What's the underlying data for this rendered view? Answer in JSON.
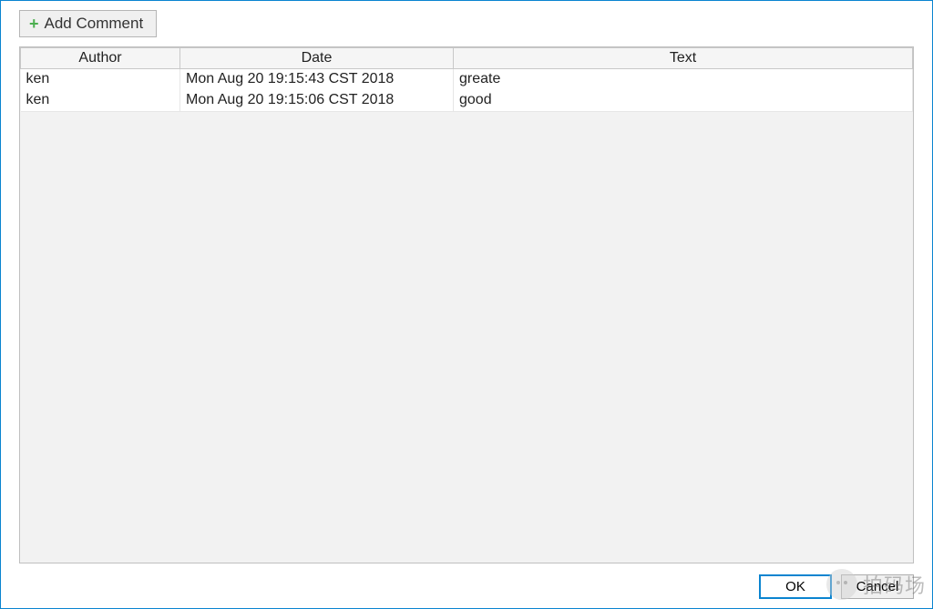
{
  "toolbar": {
    "add_comment_label": "Add Comment"
  },
  "table": {
    "headers": {
      "author": "Author",
      "date": "Date",
      "text": "Text"
    },
    "rows": [
      {
        "author": "ken",
        "date": "Mon Aug 20 19:15:43 CST 2018",
        "text": "greate"
      },
      {
        "author": "ken",
        "date": "Mon Aug 20 19:15:06 CST 2018",
        "text": "good"
      }
    ]
  },
  "footer": {
    "ok_label": "OK",
    "cancel_label": "Cancel"
  },
  "watermark": {
    "text": "拍码场"
  }
}
